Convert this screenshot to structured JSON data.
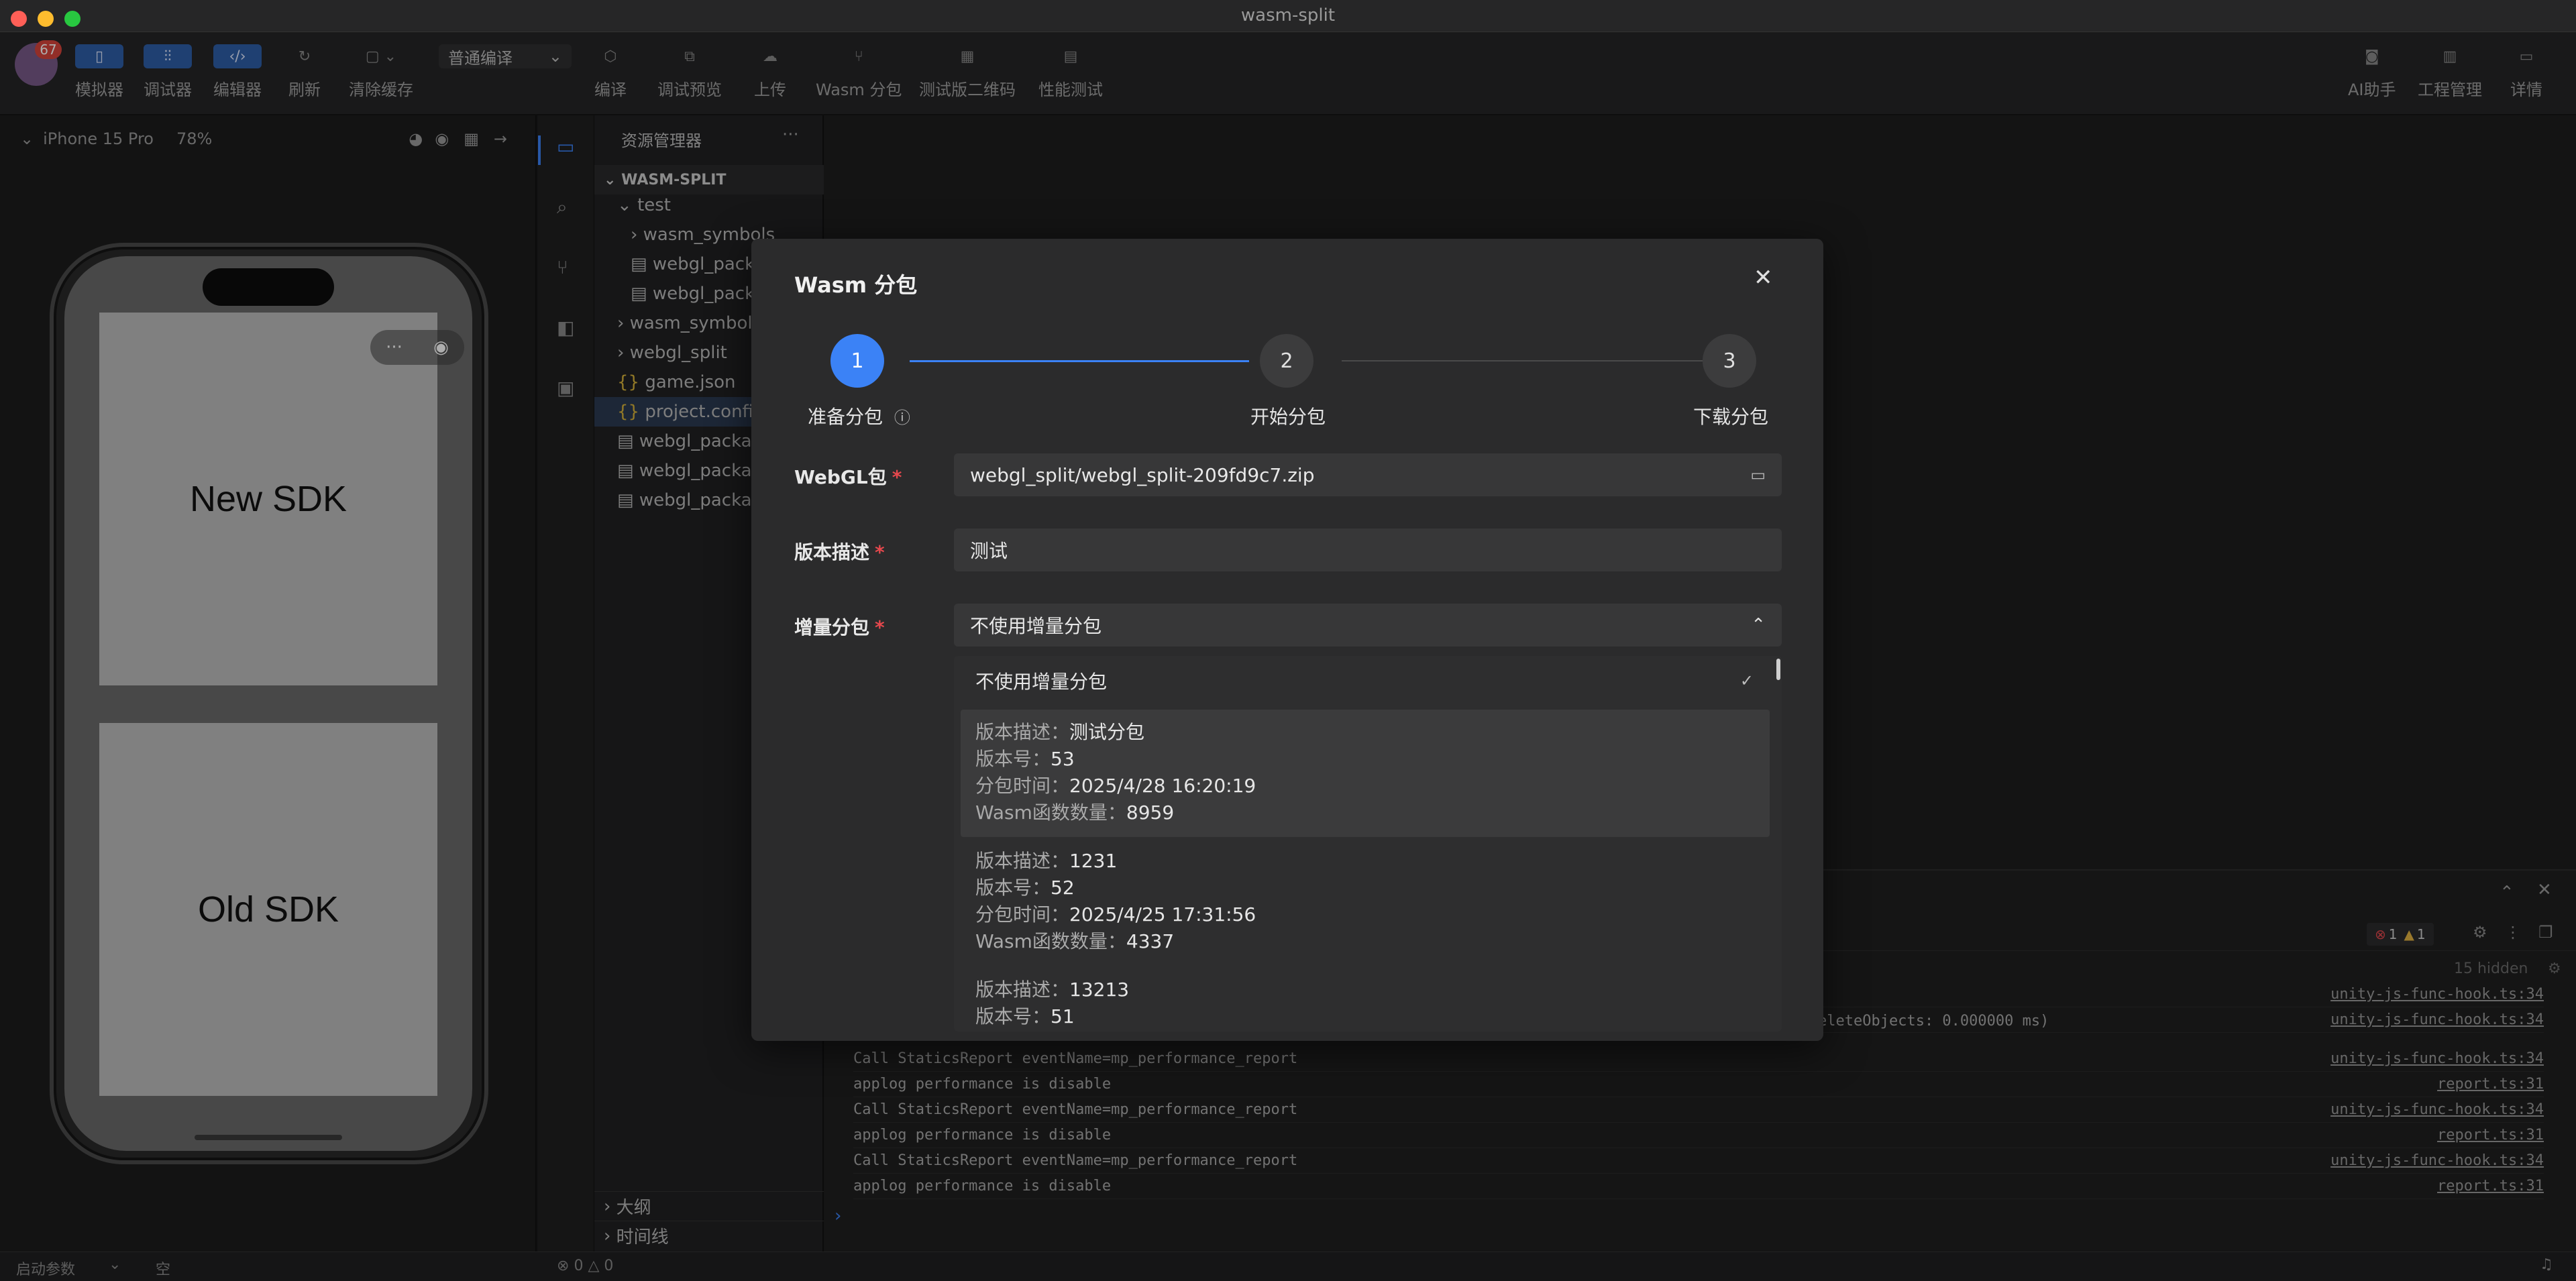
{
  "window": {
    "title": "wasm-split"
  },
  "traffic_lights": [
    "#ff5f57",
    "#febc2e",
    "#28c840"
  ],
  "avatar": {
    "badge": "67"
  },
  "toolbar": {
    "simulator": "模拟器",
    "debugger": "调试器",
    "editor": "编辑器",
    "refresh": "刷新",
    "clear_cache": "清除缓存",
    "compile_mode": "普通编译",
    "compile": "编译",
    "debug_preview": "调试预览",
    "upload": "上传",
    "wasm_split": "Wasm 分包",
    "test_qr": "测试版二维码",
    "perf_test": "性能测试",
    "ai_assistant": "AI助手",
    "project_mgmt": "工程管理",
    "details": "详情"
  },
  "simulator": {
    "device": "iPhone 15 Pro",
    "zoom": "78%",
    "panel_top": "New SDK",
    "panel_bottom": "Old SDK",
    "capsule_menu": "···"
  },
  "explorer": {
    "title": "资源管理器",
    "more": "···",
    "root": "WASM-SPLIT",
    "items": [
      {
        "name": "test",
        "kind": "folder-open"
      },
      {
        "name": "wasm_symbols",
        "kind": "folder"
      },
      {
        "name": "webgl_package-",
        "kind": "file"
      },
      {
        "name": "webgl_package-",
        "kind": "file"
      },
      {
        "name": "wasm_symbols",
        "kind": "folder"
      },
      {
        "name": "webgl_split",
        "kind": "folder"
      },
      {
        "name": "game.json",
        "kind": "json"
      },
      {
        "name": "project.config.json",
        "kind": "json"
      },
      {
        "name": "webgl_package-",
        "kind": "file"
      },
      {
        "name": "webgl_package-",
        "kind": "file"
      },
      {
        "name": "webgl_package-",
        "kind": "file"
      }
    ],
    "outline": "大纲",
    "timeline": "时间线"
  },
  "console": {
    "errors": "1",
    "warnings": "1",
    "hidden": "15 hidden",
    "partial_line": "eleteObjects: 0.000000 ms)",
    "lines": [
      {
        "text": "",
        "src": "unity-js-func-hook.ts:34"
      },
      {
        "text": "",
        "src": "unity-js-func-hook.ts:34"
      },
      {
        "text": "Call StaticsReport eventName=mp_performance_report",
        "src": "unity-js-func-hook.ts:34"
      },
      {
        "text": "applog performance is disable",
        "src": "report.ts:31"
      },
      {
        "text": "Call StaticsReport eventName=mp_performance_report",
        "src": "unity-js-func-hook.ts:34"
      },
      {
        "text": "applog performance is disable",
        "src": "report.ts:31"
      },
      {
        "text": "Call StaticsReport eventName=mp_performance_report",
        "src": "unity-js-func-hook.ts:34"
      },
      {
        "text": "applog performance is disable",
        "src": "report.ts:31"
      }
    ],
    "prompt": "›"
  },
  "statusbar": {
    "launch_params": "启动参数",
    "empty": "空",
    "errors": "0",
    "warnings": "0"
  },
  "dialog": {
    "title": "Wasm 分包",
    "close": "✕",
    "steps": [
      {
        "num": "1",
        "label": "准备分包"
      },
      {
        "num": "2",
        "label": "开始分包"
      },
      {
        "num": "3",
        "label": "下载分包"
      }
    ],
    "webgl_label": "WebGL包",
    "webgl_value": "webgl_split/webgl_split-209fd9c7.zip",
    "desc_label": "版本描述",
    "desc_value": "测试",
    "incr_label": "增量分包",
    "incr_value": "不使用增量分包",
    "required_mark": "*",
    "options": {
      "none": "不使用增量分包",
      "checkmark": "✓",
      "k_desc": "版本描述：",
      "k_version": "版本号：",
      "k_time": "分包时间：",
      "k_funcs": "Wasm函数数量：",
      "versions": [
        {
          "desc": "测试分包",
          "version": "53",
          "time": "2025/4/28 16:20:19",
          "funcs": "8959"
        },
        {
          "desc": "1231",
          "version": "52",
          "time": "2025/4/25 17:31:56",
          "funcs": "4337"
        },
        {
          "desc": "13213",
          "version": "51"
        }
      ]
    }
  },
  "colors": {
    "accent": "#3b82f6",
    "required": "#e5484d"
  }
}
